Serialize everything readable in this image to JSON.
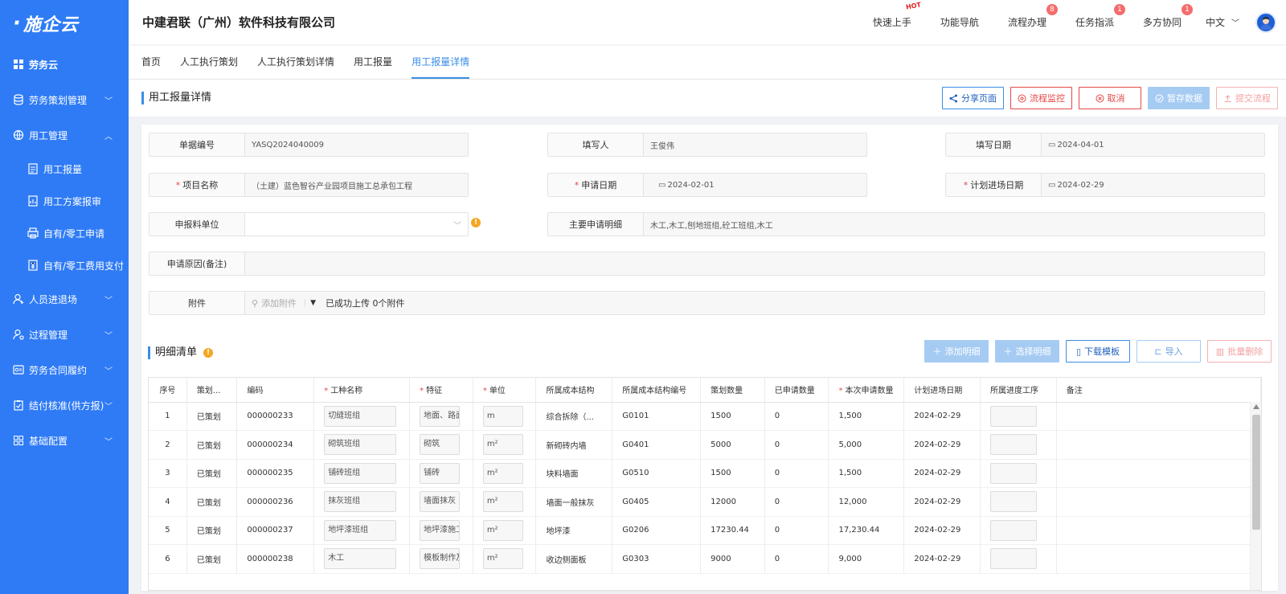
{
  "brand": {
    "logo_text": "施企云"
  },
  "sidebar": {
    "items": [
      {
        "label": "劳务云",
        "icon": "grid-icon",
        "chevron": ""
      },
      {
        "label": "劳务策划管理",
        "icon": "database-icon",
        "chevron": "down"
      },
      {
        "label": "用工管理",
        "icon": "globe-icon",
        "chevron": "up"
      },
      {
        "label": "人员进退场",
        "icon": "users-icon",
        "chevron": "down"
      },
      {
        "label": "过程管理",
        "icon": "user-settings-icon",
        "chevron": "down"
      },
      {
        "label": "劳务合同履约",
        "icon": "contract-icon",
        "chevron": "down"
      },
      {
        "label": "结付核准(供方报)",
        "icon": "clipboard-check-icon",
        "chevron": "down"
      },
      {
        "label": "基础配置",
        "icon": "apps-icon",
        "chevron": "down"
      }
    ],
    "subitems": [
      {
        "label": "用工报量"
      },
      {
        "label": "用工方案报审"
      },
      {
        "label": "自有/零工申请"
      },
      {
        "label": "自有/零工费用支付"
      }
    ]
  },
  "header": {
    "company": "中建君联（广州）软件科技有限公司",
    "links": [
      {
        "label": "快速上手",
        "badge": "",
        "hot": "HOT"
      },
      {
        "label": "功能导航",
        "badge": "",
        "hot": ""
      },
      {
        "label": "流程办理",
        "badge": "8",
        "hot": ""
      },
      {
        "label": "任务指派",
        "badge": "1",
        "hot": ""
      },
      {
        "label": "多方协同",
        "badge": "1",
        "hot": ""
      }
    ],
    "language": "中文"
  },
  "tabs": [
    "首页",
    "人工执行策划",
    "人工执行策划详情",
    "用工报量",
    "用工报量详情"
  ],
  "page": {
    "title": "用工报量详情",
    "actions": {
      "share": "分享页面",
      "monitor": "流程监控",
      "cancel": "取消",
      "save": "暂存数据",
      "submit": "提交流程"
    }
  },
  "form": {
    "doc_no": {
      "label": "单据编号",
      "value": "YASQ2024040009"
    },
    "filler": {
      "label": "填写人",
      "value": "王俊伟"
    },
    "fill_date": {
      "label": "填写日期",
      "value": "2024-04-01"
    },
    "project": {
      "label": "项目名称",
      "value": "（土建）蓝色智谷产业园项目施工总承包工程"
    },
    "apply_date": {
      "label": "申请日期",
      "value": "2024-02-01"
    },
    "plan_date": {
      "label": "计划进场日期",
      "value": "2024-02-29"
    },
    "unit": {
      "label": "申报料单位",
      "value": ""
    },
    "main_detail": {
      "label": "主要申请明细",
      "value": "木工,木工,刨地班组,砼工班组,木工"
    },
    "reason": {
      "label": "申请原因(备注)",
      "value": ""
    },
    "attachment": {
      "label": "附件",
      "add": "添加附件",
      "status": "已成功上传 0个附件"
    }
  },
  "detail": {
    "title": "明细清单",
    "buttons": {
      "add": "添加明细",
      "select": "选择明细",
      "download": "下载模板",
      "import": "导入",
      "batch_delete": "批量删除"
    },
    "columns": [
      "序号",
      "策划...",
      "编码",
      "工种名称",
      "特征",
      "单位",
      "所属成本结构",
      "所属成本结构编号",
      "策划数量",
      "已申请数量",
      "本次申请数量",
      "计划进场日期",
      "所属进度工序",
      "备注"
    ],
    "rows": [
      [
        "1",
        "已策划",
        "000000233",
        "切缝班组",
        "地面、路面",
        "m",
        "综合拆除（...",
        "G0101",
        "1500",
        "0",
        "1,500",
        "2024-02-29",
        "",
        ""
      ],
      [
        "2",
        "已策划",
        "000000234",
        "砌筑班组",
        "砌筑",
        "m²",
        "新砌砖内墙",
        "G0401",
        "5000",
        "0",
        "5,000",
        "2024-02-29",
        "",
        ""
      ],
      [
        "3",
        "已策划",
        "000000235",
        "铺砖班组",
        "铺砖",
        "m²",
        "块料墙面",
        "G0510",
        "1500",
        "0",
        "1,500",
        "2024-02-29",
        "",
        ""
      ],
      [
        "4",
        "已策划",
        "000000236",
        "抹灰班组",
        "墙面抹灰",
        "m²",
        "墙面一般抹灰",
        "G0405",
        "12000",
        "0",
        "12,000",
        "2024-02-29",
        "",
        ""
      ],
      [
        "5",
        "已策划",
        "000000237",
        "地坪漆班组",
        "地坪漆施工",
        "m²",
        "地坪漆",
        "G0206",
        "17230.44",
        "0",
        "17,230.44",
        "2024-02-29",
        "",
        ""
      ],
      [
        "6",
        "已策划",
        "000000238",
        "木工",
        "模板制作及",
        "m²",
        "收边侧面板",
        "G0303",
        "9000",
        "0",
        "9,000",
        "2024-02-29",
        "",
        ""
      ]
    ]
  },
  "colors": {
    "sidebar": "#2f7bf5",
    "accent": "#3a8ee6",
    "danger": "#e54848",
    "warning": "#f5a623"
  }
}
